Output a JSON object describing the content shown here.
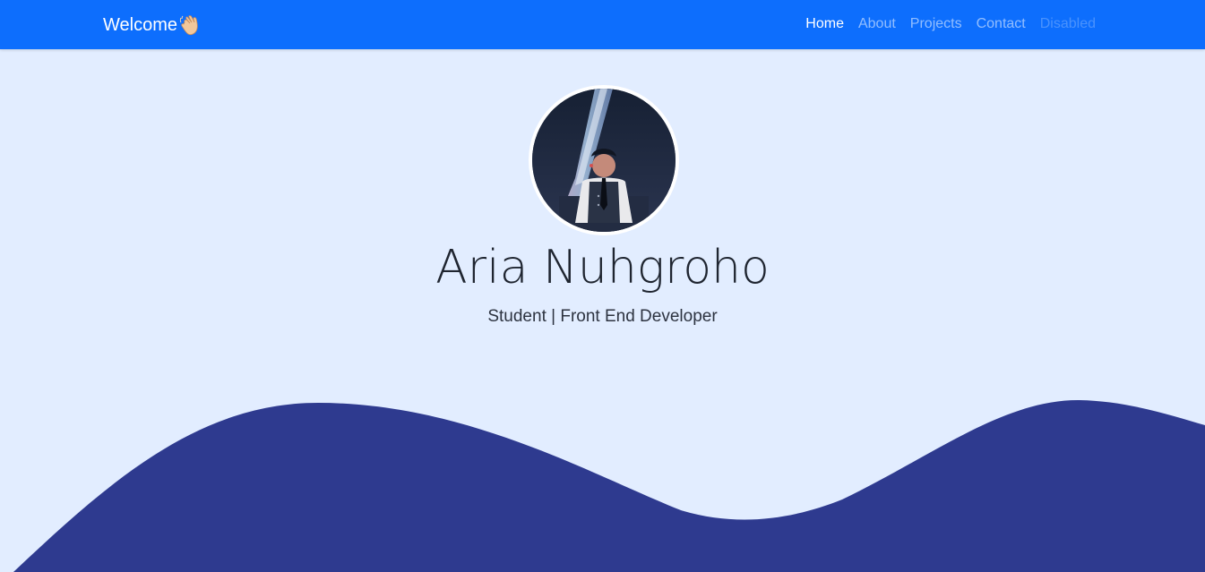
{
  "navbar": {
    "brand": "Welcome",
    "brand_icon": "waving-hand-icon",
    "links": [
      {
        "label": "Home",
        "state": "active"
      },
      {
        "label": "About",
        "state": "normal"
      },
      {
        "label": "Projects",
        "state": "normal"
      },
      {
        "label": "Contact",
        "state": "normal"
      },
      {
        "label": "Disabled",
        "state": "disabled"
      }
    ]
  },
  "hero": {
    "name": "Aria Nuhgroho",
    "subtitle": "Student | Front End Developer",
    "avatar_icon": "profile-photo"
  },
  "colors": {
    "navbar_bg": "#0d6efd",
    "page_bg": "#e2edff",
    "wave": "#2e3a8f"
  }
}
